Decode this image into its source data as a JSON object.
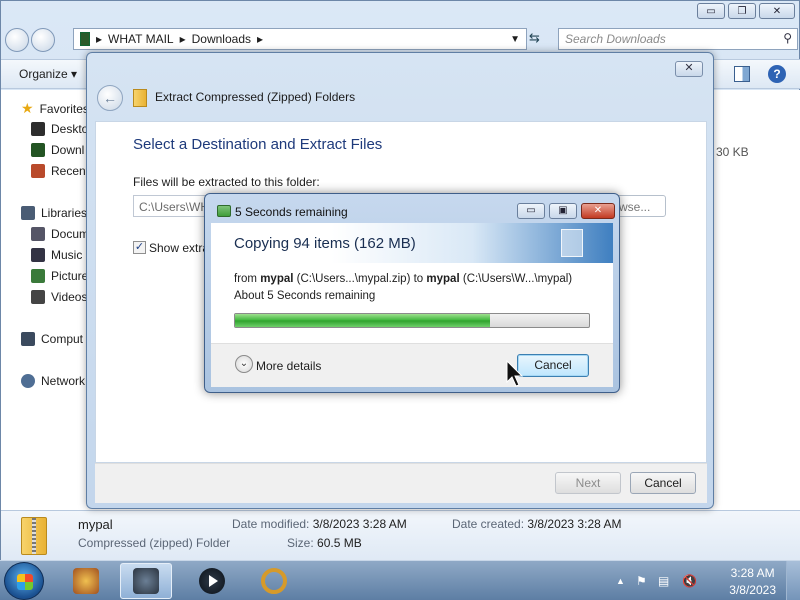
{
  "explorer": {
    "window_controls": {
      "minimize": "▭",
      "maximize": "❐",
      "close": "✕"
    },
    "address": {
      "crumbs": [
        "WHAT MAIL",
        "Downloads"
      ]
    },
    "search": {
      "placeholder": "Search Downloads"
    },
    "toolbar": {
      "organize_label": "Organize ▾"
    },
    "nav": {
      "favorites": "Favorites",
      "favorites_items": [
        "Deskto",
        "Downl",
        "Recent"
      ],
      "libraries": "Libraries",
      "libraries_items": [
        "Docum",
        "Music",
        "Picture",
        "Videos"
      ],
      "computer": "Comput",
      "network": "Network"
    },
    "size_cell": "30 KB"
  },
  "details": {
    "name": "mypal",
    "type": "Compressed (zipped) Folder",
    "date_modified_label": "Date modified:",
    "date_modified": "3/8/2023 3:28 AM",
    "date_created_label": "Date created:",
    "date_created": "3/8/2023 3:28 AM",
    "size_label": "Size:",
    "size": "60.5 MB"
  },
  "wizard": {
    "title": "Extract Compressed (Zipped) Folders",
    "heading": "Select a Destination and Extract Files",
    "extract_label": "Files will be extracted to this folder:",
    "path_value": "C:\\Users\\WH",
    "browse_label": "wse...",
    "show_label": "Show extra",
    "next_label": "Next",
    "cancel_label": "Cancel",
    "close_glyph": "✕",
    "back_glyph": "←",
    "checkbox_glyph": "✓"
  },
  "copy_dialog": {
    "title": "5 Seconds remaining",
    "heading": "Copying 94 items (162 MB)",
    "from_word": "from",
    "source_name": "mypal",
    "source_path": "(C:\\Users...\\mypal.zip)",
    "to_word": "to",
    "dest_name": "mypal",
    "dest_path": "(C:\\Users\\W...\\mypal)",
    "remaining": "About 5 Seconds remaining",
    "progress_fraction": 0.72,
    "more_details": "More details",
    "more_glyph": "⌄",
    "cancel_label": "Cancel",
    "controls": {
      "minimize": "▭",
      "maximize": "▣",
      "close": "✕"
    }
  },
  "taskbar": {
    "clock_time": "3:28 AM",
    "clock_date": "3/8/2023",
    "tray_glyphs": {
      "up_arrow": "▲",
      "flag": "⚑",
      "network": "▤",
      "volume": "🔇"
    }
  },
  "colors": {
    "progress_green": "#3cb53a",
    "heading_blue": "#1e3a7b",
    "taskbar": "#5d7ea4"
  }
}
